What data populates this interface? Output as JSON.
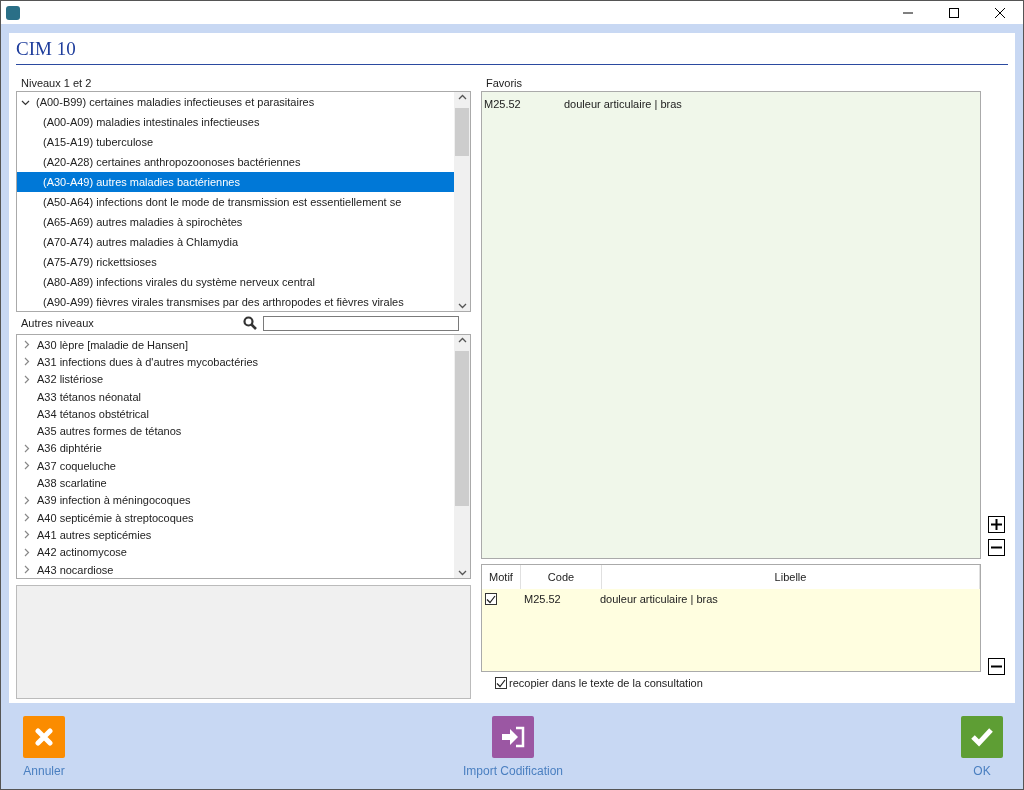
{
  "heading": "CIM 10",
  "levels": {
    "label": "Niveaux 1 et 2",
    "items": [
      {
        "label": "(A00-B99) certaines maladies infectieuses et parasitaires",
        "expanded": true,
        "selected": false,
        "children": [
          {
            "label": "(A00-A09) maladies intestinales infectieuses",
            "selected": false
          },
          {
            "label": "(A15-A19) tuberculose",
            "selected": false
          },
          {
            "label": "(A20-A28) certaines anthropozoonoses bactériennes",
            "selected": false
          },
          {
            "label": "(A30-A49) autres maladies bactériennes",
            "selected": true
          },
          {
            "label": "(A50-A64) infections dont le mode de transmission est essentiellement se",
            "selected": false
          },
          {
            "label": "(A65-A69) autres maladies à spirochètes",
            "selected": false
          },
          {
            "label": "(A70-A74) autres maladies à Chlamydia",
            "selected": false
          },
          {
            "label": "(A75-A79) rickettsioses",
            "selected": false
          },
          {
            "label": "(A80-A89) infections virales du système nerveux central",
            "selected": false
          },
          {
            "label": "(A90-A99) fièvres virales transmises par des arthropodes et fièvres virales",
            "selected": false
          }
        ]
      }
    ]
  },
  "other_levels": {
    "label": "Autres niveaux",
    "items": [
      {
        "label": "A30 lèpre [maladie de Hansen]",
        "expandable": true
      },
      {
        "label": "A31 infections dues à d'autres mycobactéries",
        "expandable": true
      },
      {
        "label": "A32 listériose",
        "expandable": true
      },
      {
        "label": "A33 tétanos néonatal",
        "expandable": false
      },
      {
        "label": "A34 tétanos obstétrical",
        "expandable": false
      },
      {
        "label": "A35 autres formes de tétanos",
        "expandable": false
      },
      {
        "label": "A36 diphtérie",
        "expandable": true
      },
      {
        "label": "A37 coqueluche",
        "expandable": true
      },
      {
        "label": "A38 scarlatine",
        "expandable": false
      },
      {
        "label": "A39 infection à méningocoques",
        "expandable": true
      },
      {
        "label": "A40 septicémie à streptocoques",
        "expandable": true
      },
      {
        "label": "A41 autres septicémies",
        "expandable": true
      },
      {
        "label": "A42 actinomycose",
        "expandable": true
      },
      {
        "label": "A43 nocardiose",
        "expandable": true
      }
    ]
  },
  "favorites": {
    "label": "Favoris",
    "rows": [
      {
        "code": "M25.52",
        "label": "douleur articulaire | bras"
      }
    ]
  },
  "selection": {
    "columns": [
      "Motif",
      "Code",
      "Libelle"
    ],
    "rows": [
      {
        "checked": true,
        "code": "M25.52",
        "label": "douleur articulaire | bras"
      }
    ]
  },
  "copy_option": {
    "label": "recopier dans le texte de la consultation",
    "checked": true
  },
  "buttons": [
    {
      "kind": "cancel",
      "label": "Annuler"
    },
    {
      "kind": "import",
      "label": "Import Codification"
    },
    {
      "kind": "ok",
      "label": "OK"
    }
  ]
}
